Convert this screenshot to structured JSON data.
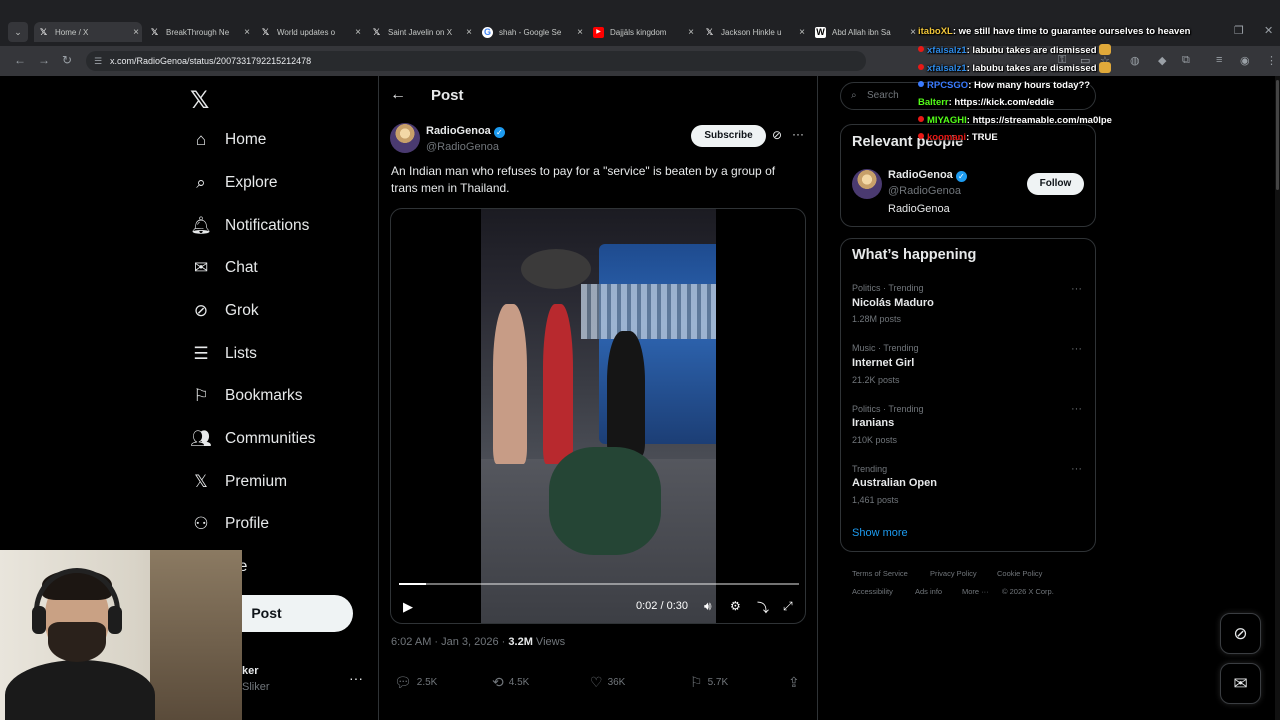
{
  "browser": {
    "tabs": [
      {
        "title": "Home / X",
        "icon": "x-logo-icon"
      },
      {
        "title": "BreakThrough Ne",
        "icon": "x-logo-icon"
      },
      {
        "title": "World updates o",
        "icon": "x-logo-icon"
      },
      {
        "title": "Saint Javelin on X",
        "icon": "x-logo-icon"
      },
      {
        "title": "shah - Google Se",
        "icon": "google-icon"
      },
      {
        "title": "Dajjāls kingdom",
        "icon": "youtube-icon"
      },
      {
        "title": "Jackson Hinkle u",
        "icon": "x-logo-icon"
      },
      {
        "title": "Abd Allah ibn Sa",
        "icon": "wikipedia-icon"
      }
    ],
    "url": "x.com/RadioGenoa/status/2007331792215212478"
  },
  "nav": {
    "items": [
      {
        "label": "Home",
        "icon": "home-icon"
      },
      {
        "label": "Explore",
        "icon": "search-icon"
      },
      {
        "label": "Notifications",
        "icon": "bell-icon"
      },
      {
        "label": "Chat",
        "icon": "mail-icon"
      },
      {
        "label": "Grok",
        "icon": "grok-icon"
      },
      {
        "label": "Lists",
        "icon": "list-icon"
      },
      {
        "label": "Bookmarks",
        "icon": "bookmark-icon"
      },
      {
        "label": "Communities",
        "icon": "people-icon"
      },
      {
        "label": "Premium",
        "icon": "x-logo-icon"
      },
      {
        "label": "Profile",
        "icon": "person-icon"
      },
      {
        "label": "ore",
        "icon": "more-icon"
      }
    ],
    "post_label": "Post",
    "account_name": "ker",
    "account_handle": "Sliker"
  },
  "post": {
    "header": "Post",
    "author_name": "RadioGenoa",
    "author_handle": "@RadioGenoa",
    "subscribe_label": "Subscribe",
    "text": "An Indian man who refuses to pay for a \"service\" is beaten by a group of trans men in Thailand.",
    "video": {
      "time": "0:02 / 0:30",
      "progress": 0.067
    },
    "timestamp": "6:02 AM · Jan 3, 2026 · ",
    "views": "3.2M",
    "views_label": " Views",
    "actions": {
      "replies": "2.5K",
      "reposts": "4.5K",
      "likes": "36K",
      "bookmarks": "5.7K"
    }
  },
  "sidebar": {
    "search_placeholder": "Search",
    "relevant_title": "Relevant people",
    "relevant": {
      "name": "RadioGenoa",
      "handle": "@RadioGenoa",
      "bio": "RadioGenoa",
      "follow_label": "Follow"
    },
    "happening_title": "What’s happening",
    "trends": [
      {
        "category": "Politics · Trending",
        "name": "Nicolás Maduro",
        "count": "1.28M posts"
      },
      {
        "category": "Music · Trending",
        "name": "Internet Girl",
        "count": "21.2K posts"
      },
      {
        "category": "Politics · Trending",
        "name": "Iranians",
        "count": "210K posts"
      },
      {
        "category": "Trending",
        "name": "Australian Open",
        "count": "1,461 posts"
      }
    ],
    "show_more": "Show more",
    "footer": [
      "Terms of Service",
      "Privacy Policy",
      "Cookie Policy",
      "Accessibility",
      "Ads info",
      "More ···",
      "© 2026 X Corp."
    ]
  },
  "chat": [
    {
      "user": "itaboXL",
      "msg": ": we still have time to guarantee ourselves to heaven",
      "color": "#f0c53a"
    },
    {
      "user": "xfaisalz1",
      "msg": ": labubu takes are dismissed",
      "color": "#2e8ae6"
    },
    {
      "user": "xfaisalz1",
      "msg": ": labubu takes are dismissed",
      "color": "#2e8ae6"
    },
    {
      "user": "RPCSGO",
      "msg": ": How many hours today??",
      "color": "#3a7bff"
    },
    {
      "user": "Balterr",
      "msg": ": https://kick.com/eddie",
      "color": "#53fc18"
    },
    {
      "user": "MIYAGHI",
      "msg": ": https://streamable.com/ma0lpe",
      "color": "#53fc18"
    },
    {
      "user": "koomani",
      "msg": ": TRUE",
      "color": "#e91916"
    }
  ],
  "colors": {
    "accent": "#1d9bf0",
    "background": "#000000",
    "border": "#2f3336"
  }
}
